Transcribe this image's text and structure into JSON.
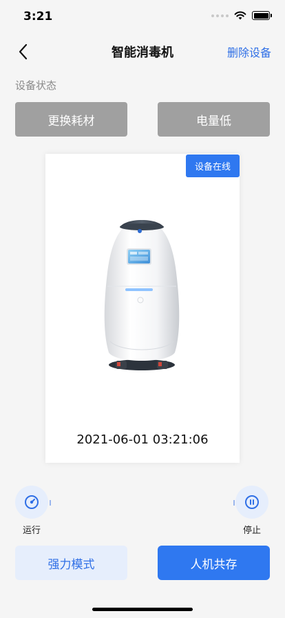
{
  "status_bar": {
    "time": "3:21"
  },
  "nav": {
    "title": "智能消毒机",
    "action_label": "删除设备"
  },
  "device_status": {
    "section_label": "设备状态",
    "buttons": [
      {
        "label": "更换耗材"
      },
      {
        "label": "电量低"
      }
    ]
  },
  "device_card": {
    "online_badge": "设备在线",
    "timestamp": "2021-06-01 03:21:06"
  },
  "controls": {
    "run_label": "运行",
    "stop_label": "停止"
  },
  "modes": {
    "strong_label": "强力模式",
    "coexist_label": "人机共存"
  },
  "colors": {
    "accent": "#2f78f0",
    "link": "#2f6fe6",
    "status_gray": "#a0a0a0",
    "light_accent_bg": "#e6eefc"
  },
  "icons": {
    "back": "chevron-left-icon",
    "wifi": "wifi-icon",
    "battery": "battery-icon",
    "run": "gauge-icon",
    "stop": "pause-icon"
  }
}
